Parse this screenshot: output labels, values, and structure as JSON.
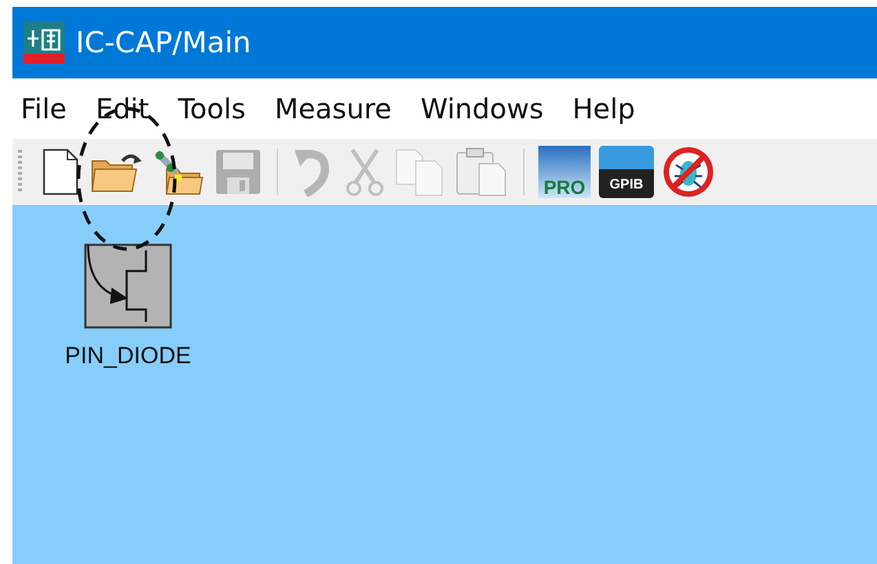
{
  "window": {
    "title": "IC-CAP/Main"
  },
  "menu": [
    "File",
    "Edit",
    "Tools",
    "Measure",
    "Windows",
    "Help"
  ],
  "toolbar": [
    {
      "kind": "new",
      "disabled": false
    },
    {
      "kind": "open",
      "disabled": false
    },
    {
      "kind": "open-example",
      "disabled": false
    },
    {
      "kind": "save",
      "disabled": true
    },
    {
      "kind": "separator"
    },
    {
      "kind": "undo",
      "disabled": true
    },
    {
      "kind": "cut",
      "disabled": true
    },
    {
      "kind": "copy",
      "disabled": true
    },
    {
      "kind": "paste",
      "disabled": true
    },
    {
      "kind": "separator"
    },
    {
      "kind": "pro",
      "label": "PRO",
      "disabled": false
    },
    {
      "kind": "gpib",
      "label": "GPIB",
      "disabled": false
    },
    {
      "kind": "nobug",
      "disabled": false
    }
  ],
  "models": [
    {
      "name": "PIN_DIODE"
    }
  ]
}
